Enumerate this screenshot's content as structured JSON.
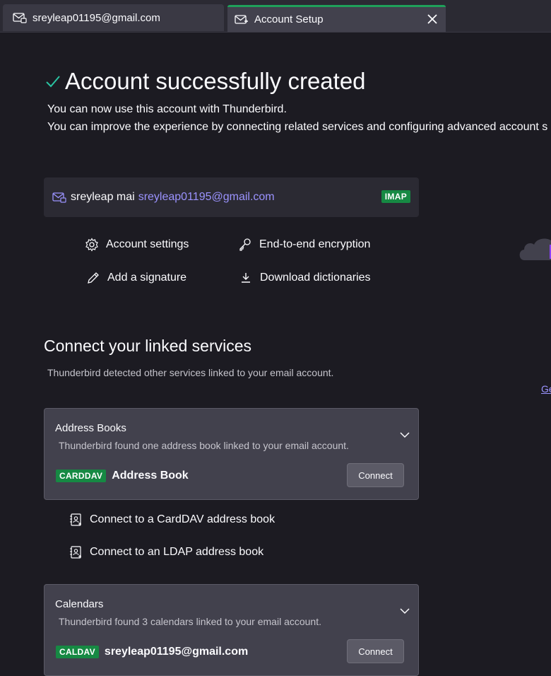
{
  "tabs": [
    {
      "label": "sreyleap01195@gmail.com"
    },
    {
      "label": "Account Setup"
    }
  ],
  "header": {
    "title": "Account successfully created",
    "line1": "You can now use this account with Thunderbird.",
    "line2": "You can improve the experience by connecting related services and configuring advanced account s"
  },
  "account": {
    "name": "sreyleap mai",
    "email": "sreyleap01195@gmail.com",
    "protocol": "IMAP"
  },
  "actions": {
    "settings": "Account settings",
    "encryption": "End-to-end encryption",
    "signature": "Add a signature",
    "dictionaries": "Download dictionaries"
  },
  "linked": {
    "title": "Connect your linked services",
    "subtitle": "Thunderbird detected other services linked to your email account.",
    "side_link": "Ge"
  },
  "address_books": {
    "title": "Address Books",
    "description": "Thunderbird found one address book linked to your email account.",
    "badge": "CARDDAV",
    "item": "Address Book",
    "button": "Connect",
    "link_carddav": "Connect to a CardDAV address book",
    "link_ldap": "Connect to an LDAP address book"
  },
  "calendars": {
    "title": "Calendars",
    "description": "Thunderbird found 3 calendars linked to your email account.",
    "badge": "CALDAV",
    "item": "sreyleap01195@gmail.com",
    "button": "Connect"
  },
  "colors": {
    "background": "#1c1b22",
    "accent_link": "#9b93ff",
    "badge_green": "#168943",
    "success_check": "#2ac3a2"
  }
}
